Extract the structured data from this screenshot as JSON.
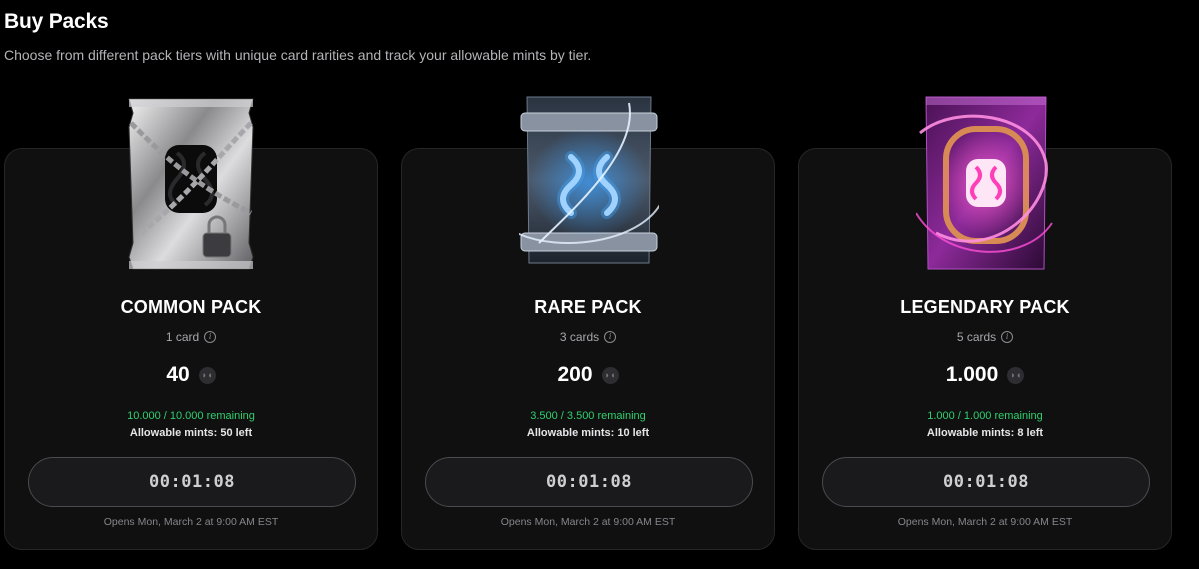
{
  "header": {
    "title": "Buy Packs",
    "subtitle": "Choose from different pack tiers with unique card rarities and track your allowable mints by tier."
  },
  "packs": [
    {
      "name": "COMMON PACK",
      "cards": "1 card",
      "price": "40",
      "remaining": "10.000 / 10.000 remaining",
      "mints": "Allowable mints: 50 left",
      "timer": "00:01:08",
      "opens": "Opens Mon, March 2 at 9:00 AM EST",
      "accent": "#c9c9cc",
      "icons": {
        "art": "chained-silver-pack-icon"
      }
    },
    {
      "name": "RARE PACK",
      "cards": "3 cards",
      "price": "200",
      "remaining": "3.500 / 3.500 remaining",
      "mints": "Allowable mints: 10 left",
      "timer": "00:01:08",
      "opens": "Opens Mon, March 2 at 9:00 AM EST",
      "accent": "#6fb8ff",
      "icons": {
        "art": "neon-blue-pack-icon"
      }
    },
    {
      "name": "LEGENDARY PACK",
      "cards": "5 cards",
      "price": "1.000",
      "remaining": "1.000 / 1.000 remaining",
      "mints": "Allowable mints: 8 left",
      "timer": "00:01:08",
      "opens": "Opens Mon, March 2 at 9:00 AM EST",
      "accent": "#ff4fd8",
      "icons": {
        "art": "neon-pink-pack-icon"
      }
    }
  ],
  "colors": {
    "background": "#000000",
    "card": "#101011",
    "remaining": "#2fd06e"
  }
}
